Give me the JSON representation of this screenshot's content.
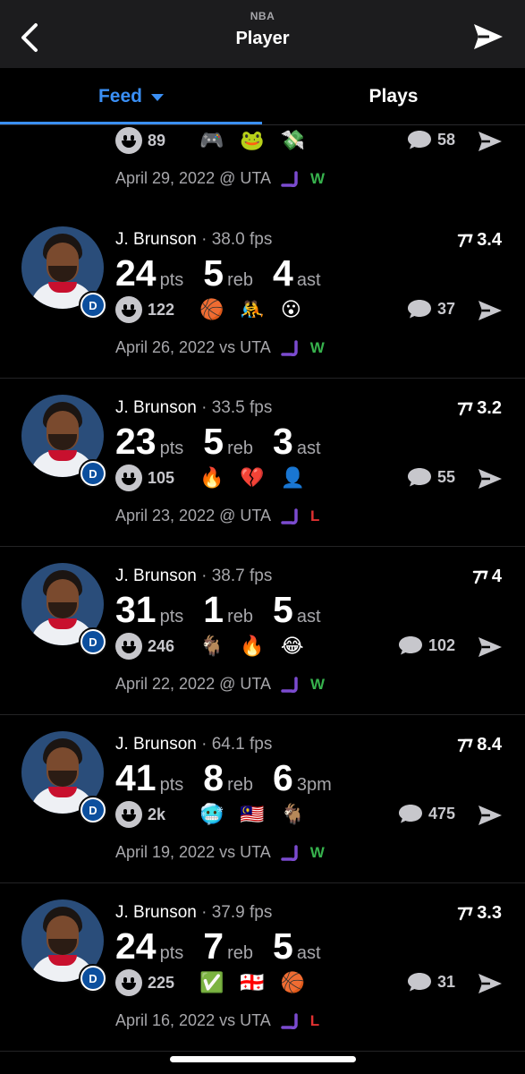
{
  "header": {
    "league": "NBA",
    "title": "Player"
  },
  "tabs": [
    {
      "label": "Feed",
      "active": true
    },
    {
      "label": "Plays",
      "active": false
    }
  ],
  "colors": {
    "accent": "#3a8ff5",
    "win": "#37b24d",
    "loss": "#e03131"
  },
  "feed": {
    "partial_card": {
      "reactions": "89",
      "emojis": [
        "🎮",
        "🐸",
        "💸"
      ],
      "comments": "58",
      "date": "April 29, 2022 @ UTA",
      "result": "W"
    },
    "cards": [
      {
        "player": "J. Brunson",
        "fps": " · 38.0 fps",
        "rank": "3.4",
        "stats": [
          {
            "v": "24",
            "l": "pts"
          },
          {
            "v": "5",
            "l": "reb"
          },
          {
            "v": "4",
            "l": "ast"
          }
        ],
        "reactions": "122",
        "emojis": [
          "🏀",
          "🤼",
          "😮"
        ],
        "comments": "37",
        "date": "April 26, 2022 vs UTA",
        "result": "W"
      },
      {
        "player": "J. Brunson",
        "fps": " · 33.5 fps",
        "rank": "3.2",
        "stats": [
          {
            "v": "23",
            "l": "pts"
          },
          {
            "v": "5",
            "l": "reb"
          },
          {
            "v": "3",
            "l": "ast"
          }
        ],
        "reactions": "105",
        "emojis": [
          "🔥",
          "💔",
          "👤"
        ],
        "comments": "55",
        "date": "April 23, 2022 @ UTA",
        "result": "L"
      },
      {
        "player": "J. Brunson",
        "fps": " · 38.7 fps",
        "rank": "4",
        "stats": [
          {
            "v": "31",
            "l": "pts"
          },
          {
            "v": "1",
            "l": "reb"
          },
          {
            "v": "5",
            "l": "ast"
          }
        ],
        "reactions": "246",
        "emojis": [
          "🐐",
          "🔥",
          "😂"
        ],
        "comments": "102",
        "date": "April 22, 2022 @ UTA",
        "result": "W"
      },
      {
        "player": "J. Brunson",
        "fps": " · 64.1 fps",
        "rank": "8.4",
        "stats": [
          {
            "v": "41",
            "l": "pts"
          },
          {
            "v": "8",
            "l": "reb"
          },
          {
            "v": "6",
            "l": "3pm"
          }
        ],
        "reactions": "2k",
        "emojis": [
          "🥶",
          "🇲🇾",
          "🐐"
        ],
        "comments": "475",
        "date": "April 19, 2022 vs UTA",
        "result": "W"
      },
      {
        "player": "J. Brunson",
        "fps": " · 37.9 fps",
        "rank": "3.3",
        "stats": [
          {
            "v": "24",
            "l": "pts"
          },
          {
            "v": "7",
            "l": "reb"
          },
          {
            "v": "5",
            "l": "ast"
          }
        ],
        "reactions": "225",
        "emojis": [
          "✅",
          "🇬🇪",
          "🏀"
        ],
        "comments": "31",
        "date": "April 16, 2022 vs UTA",
        "result": "L"
      }
    ]
  }
}
